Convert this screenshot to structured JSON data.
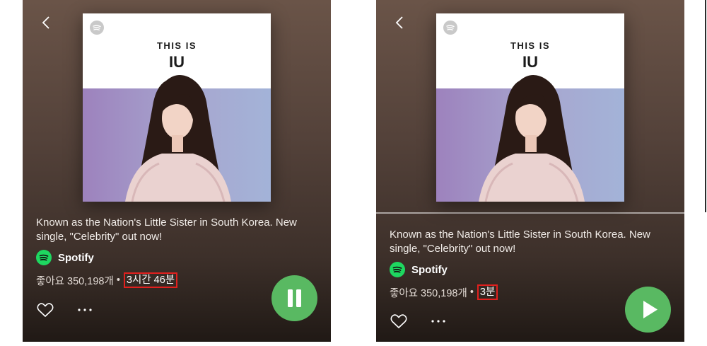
{
  "left_screen": {
    "cover": {
      "kicker": "THIS IS",
      "title": "IU"
    },
    "description": "Known as the Nation's Little Sister in South Korea. New single, \"Celebrity\" out now!",
    "publisher": "Spotify",
    "likes": "좋아요 350,198개",
    "separator": "•",
    "duration": "3시간 46분",
    "playback_state": "playing",
    "highlight_color": "#e0201e",
    "accent_color": "#59b962"
  },
  "right_screen": {
    "cover": {
      "kicker": "THIS IS",
      "title": "IU"
    },
    "description": "Known as the Nation's Little Sister in South Korea. New single, \"Celebrity\" out now!",
    "publisher": "Spotify",
    "likes": "좋아요 350,198개",
    "separator": "•",
    "duration": "3분",
    "playback_state": "paused",
    "highlight_color": "#e0201e",
    "accent_color": "#59b962"
  },
  "icons": {
    "back": "chevron-left-icon",
    "like": "heart-icon",
    "more": "more-icon",
    "pause": "pause-icon",
    "play": "play-icon",
    "publisher": "spotify-logo-icon"
  }
}
